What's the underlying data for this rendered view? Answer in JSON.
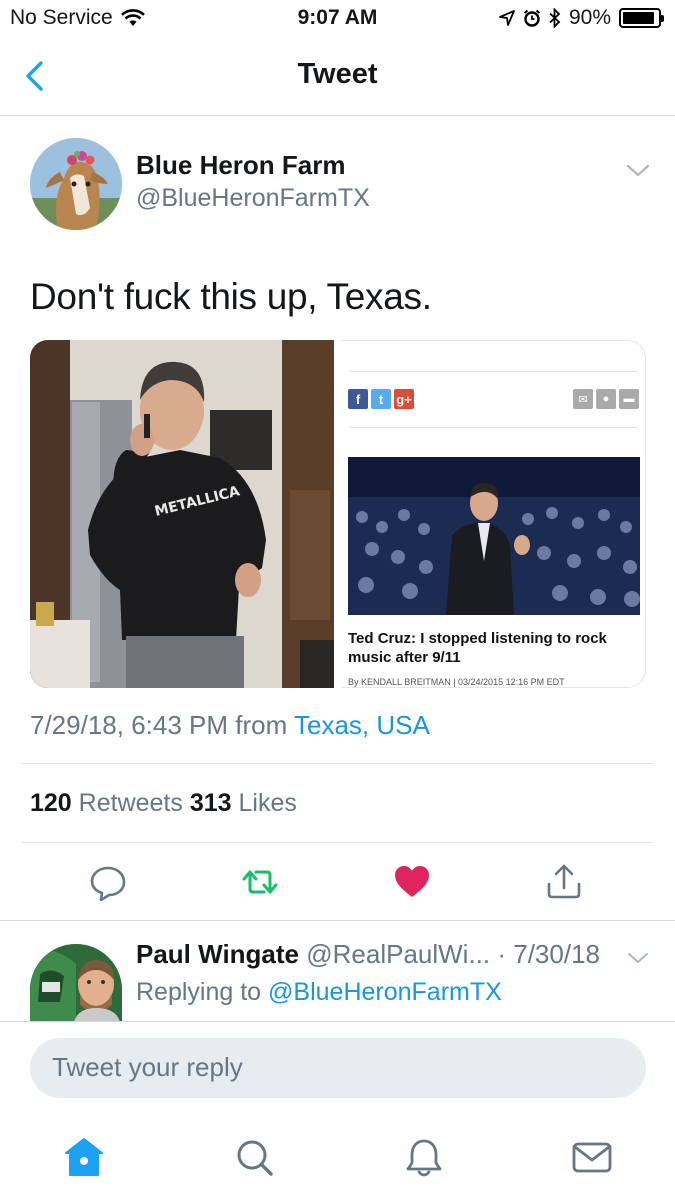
{
  "status_bar": {
    "carrier": "No Service",
    "time": "9:07 AM",
    "battery": "90%",
    "battery_level": 0.9
  },
  "nav": {
    "title": "Tweet",
    "back_icon": "chevron-left-icon"
  },
  "tweet": {
    "author_name": "Blue Heron Farm",
    "author_handle": "@BlueHeronFarmTX",
    "text": "Don't fuck this up, Texas.",
    "date": "7/29/18, 6:43 PM from ",
    "location": "Texas, USA",
    "retweets_count": "120",
    "retweets_label": " Retweets ",
    "likes_count": "313",
    "likes_label": " Likes",
    "liked": true,
    "media": {
      "photo_shirt_text": "METALLICA",
      "article": {
        "share_buttons": [
          "f",
          "t",
          "g+"
        ],
        "headline": "Ted Cruz: I stopped listening to rock music after 9/11",
        "byline": "By KENDALL BREITMAN | 03/24/2015 12:16 PM EDT"
      }
    }
  },
  "reply": {
    "name": "Paul Wingate",
    "handle": " @RealPaulWi... ",
    "date": "· 7/30/18",
    "replying_prefix": "Replying to ",
    "replying_to": "@BlueHeronFarmTX"
  },
  "composer": {
    "placeholder": "Tweet your reply"
  },
  "colors": {
    "accent": "#1da1f2",
    "retweet": "#17bf63",
    "like": "#e0245e",
    "secondary_text": "#657786"
  },
  "tab_bar": [
    "home-icon",
    "search-icon",
    "notifications-icon",
    "messages-icon"
  ]
}
